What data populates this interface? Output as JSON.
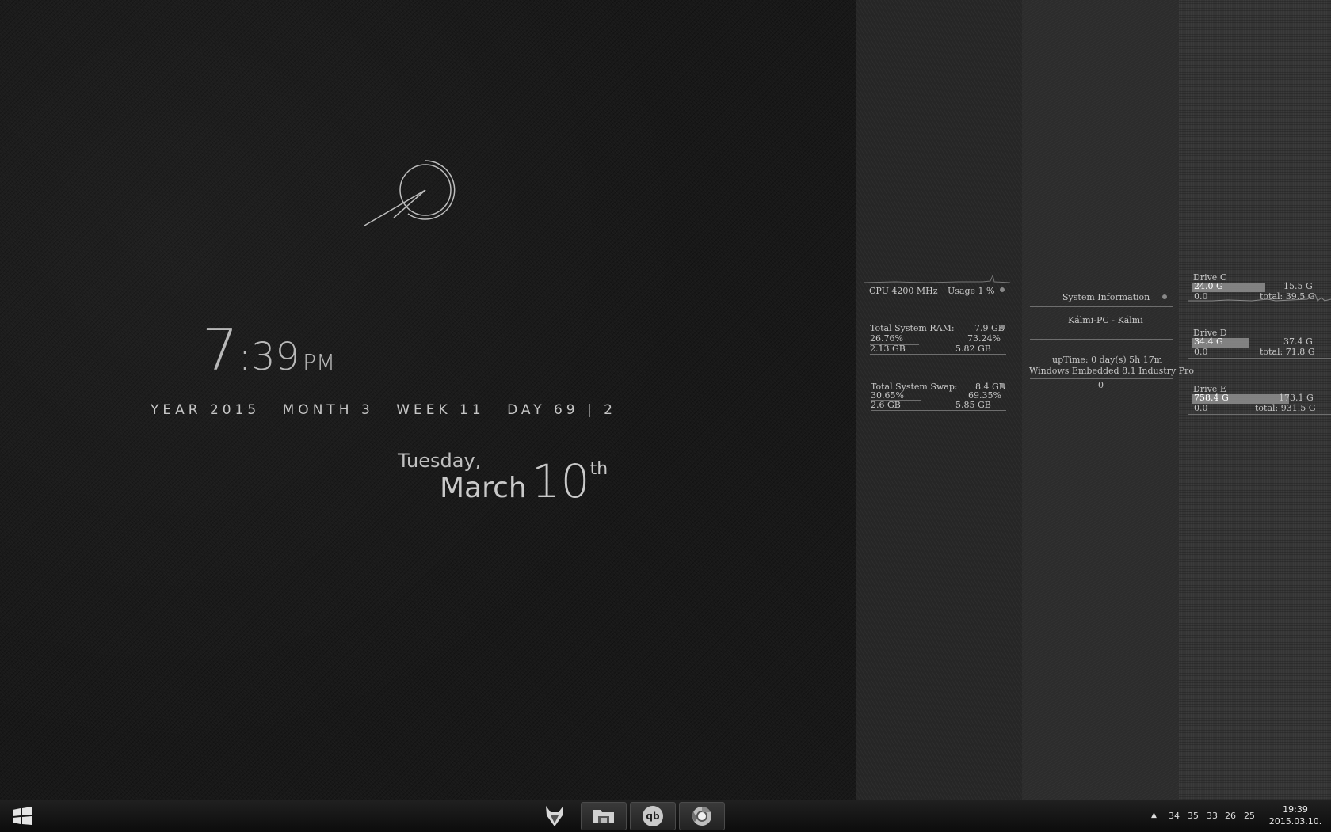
{
  "clock": {
    "hour": "7",
    "minutes": ":39",
    "ampm": "PM"
  },
  "calendar": {
    "year": "YEAR 2015",
    "month": "MONTH 3",
    "week": "WEEK 11",
    "day": "DAY 69 | 2"
  },
  "date": {
    "dayname": "Tuesday,",
    "month": "March",
    "day": "10",
    "suffix": "th"
  },
  "cpu": {
    "freq": "CPU 4200 MHz",
    "usage": "Usage 1 %",
    "ram_label": "Total System RAM:",
    "ram_total": "7.9 GB",
    "ram_pct_used": "26.76%",
    "ram_pct_free": "73.24%",
    "ram_used": "2.13 GB",
    "ram_free": "5.82 GB",
    "swap_label": "Total System Swap:",
    "swap_total": "8.4 GB",
    "swap_pct_used": "30.65%",
    "swap_pct_free": "69.35%",
    "swap_used": "2.6 GB",
    "swap_free": "5.85 GB"
  },
  "sysinfo": {
    "title": "System Information",
    "host": "Kálmi-PC - Kálmi",
    "uptime": "upTime: 0 day(s) 5h 17m",
    "os": "Windows Embedded 8.1 Industry Pro",
    "extra": "0"
  },
  "drives": [
    {
      "name": "Drive C",
      "used": "24.0 G",
      "free": "15.5 G",
      "zero": "0.0",
      "total": "total: 39.5 G",
      "fill": 0.61
    },
    {
      "name": "Drive D",
      "used": "34.4 G",
      "free": "37.4 G",
      "zero": "0.0",
      "total": "total: 71.8 G",
      "fill": 0.48
    },
    {
      "name": "Drive E",
      "used": "758.4 G",
      "free": "173.1 G",
      "zero": "0.0",
      "total": "total: 931.5 G",
      "fill": 0.81
    }
  ],
  "taskbar": {
    "apps": [
      "start-icon",
      "fox-icon",
      "file-explorer-icon",
      "qbittorrent-icon",
      "chrome-icon"
    ],
    "qb_label": "qb",
    "tray_arrow": "▲",
    "temps": [
      "34",
      "35",
      "33",
      "26",
      "25"
    ],
    "time": "19:39",
    "date": "2015.03.10."
  }
}
